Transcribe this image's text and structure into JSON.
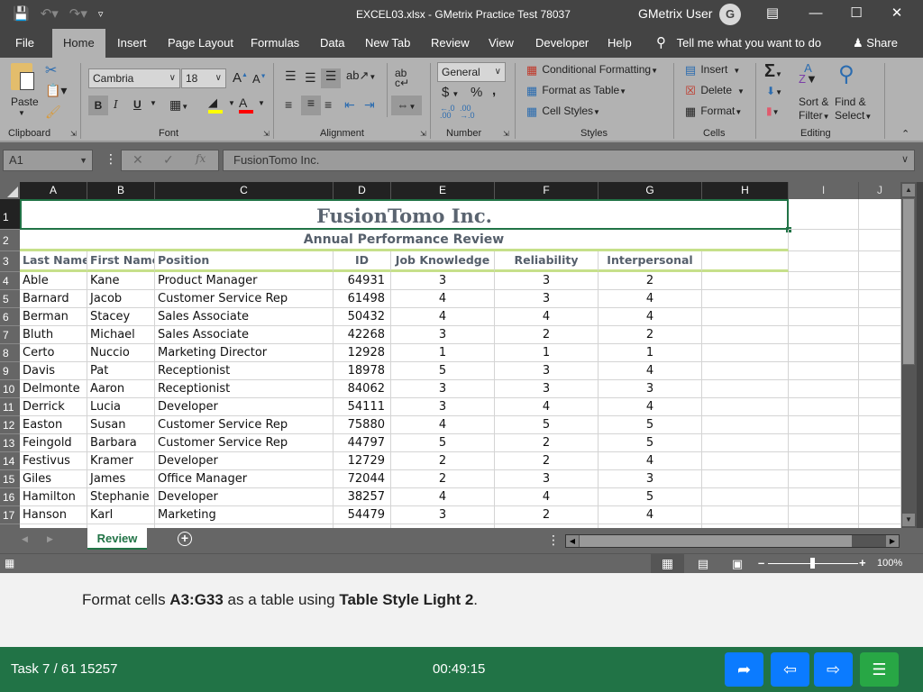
{
  "window": {
    "title": "EXCEL03.xlsx  -  GMetrix Practice Test 78037",
    "user_name": "GMetrix User",
    "user_initial": "G"
  },
  "quick_access": {
    "save_icon": "save-icon",
    "undo_icon": "undo-icon",
    "redo_icon": "redo-icon",
    "customize_icon": "customize-qat-icon"
  },
  "ribbon_tabs": [
    {
      "label": "File"
    },
    {
      "label": "Home",
      "active": true
    },
    {
      "label": "Insert"
    },
    {
      "label": "Page Layout"
    },
    {
      "label": "Formulas"
    },
    {
      "label": "Data"
    },
    {
      "label": "New Tab"
    },
    {
      "label": "Review"
    },
    {
      "label": "View"
    },
    {
      "label": "Developer"
    },
    {
      "label": "Help"
    }
  ],
  "tell_me": "Tell me what you want to do",
  "share": "Share",
  "ribbon": {
    "clipboard": {
      "label": "Clipboard",
      "paste": "Paste"
    },
    "font": {
      "label": "Font",
      "font_name": "Cambria",
      "font_size": "18",
      "bold": "B",
      "italic": "I",
      "underline": "U",
      "fill_color": "#ffff00",
      "font_color": "#ff0000"
    },
    "alignment": {
      "label": "Alignment"
    },
    "number": {
      "label": "Number",
      "format": "General",
      "currency": "$",
      "percent": "%",
      "comma": ","
    },
    "styles": {
      "label": "Styles",
      "conditional_formatting": "Conditional Formatting",
      "format_as_table": "Format as Table",
      "cell_styles": "Cell Styles"
    },
    "cells": {
      "label": "Cells",
      "insert": "Insert",
      "delete": "Delete",
      "format": "Format"
    },
    "editing": {
      "label": "Editing",
      "sort_filter_1": "Sort &",
      "sort_filter_2": "Filter",
      "find_select_1": "Find &",
      "find_select_2": "Select"
    }
  },
  "formula_bar": {
    "name_box": "A1",
    "fx": "fx",
    "content": "FusionTomo Inc."
  },
  "columns": [
    "A",
    "B",
    "C",
    "D",
    "E",
    "F",
    "G",
    "H",
    "I",
    "J"
  ],
  "sheet": {
    "title": "FusionTomo Inc.",
    "subtitle": "Annual Performance Review",
    "headers": [
      "Last Name",
      "First Name",
      "Position",
      "ID",
      "Job Knowledge",
      "Reliability",
      "Interpersonal"
    ],
    "rows": [
      {
        "row": "4",
        "cells": [
          "Able",
          "Kane",
          "Product Manager",
          "64931",
          "3",
          "3",
          "2"
        ]
      },
      {
        "row": "5",
        "cells": [
          "Barnard",
          "Jacob",
          "Customer Service Rep",
          "61498",
          "4",
          "3",
          "4"
        ]
      },
      {
        "row": "6",
        "cells": [
          "Berman",
          "Stacey",
          "Sales Associate",
          "50432",
          "4",
          "4",
          "4"
        ]
      },
      {
        "row": "7",
        "cells": [
          "Bluth",
          "Michael",
          "Sales Associate",
          "42268",
          "3",
          "2",
          "2"
        ]
      },
      {
        "row": "8",
        "cells": [
          "Certo",
          "Nuccio",
          "Marketing Director",
          "12928",
          "1",
          "1",
          "1"
        ]
      },
      {
        "row": "9",
        "cells": [
          "Davis",
          "Pat",
          "Receptionist",
          "18978",
          "5",
          "3",
          "4"
        ]
      },
      {
        "row": "10",
        "cells": [
          "Delmonte",
          "Aaron",
          "Receptionist",
          "84062",
          "3",
          "3",
          "3"
        ]
      },
      {
        "row": "11",
        "cells": [
          "Derrick",
          "Lucia",
          "Developer",
          "54111",
          "3",
          "4",
          "4"
        ]
      },
      {
        "row": "12",
        "cells": [
          "Easton",
          "Susan",
          "Customer Service Rep",
          "75880",
          "4",
          "5",
          "5"
        ]
      },
      {
        "row": "13",
        "cells": [
          "Feingold",
          "Barbara",
          "Customer Service Rep",
          "44797",
          "5",
          "2",
          "5"
        ]
      },
      {
        "row": "14",
        "cells": [
          "Festivus",
          "Kramer",
          "Developer",
          "12729",
          "2",
          "2",
          "4"
        ]
      },
      {
        "row": "15",
        "cells": [
          "Giles",
          "James",
          "Office Manager",
          "72044",
          "2",
          "3",
          "3"
        ]
      },
      {
        "row": "16",
        "cells": [
          "Hamilton",
          "Stephanie",
          "Developer",
          "38257",
          "4",
          "4",
          "5"
        ]
      },
      {
        "row": "17",
        "cells": [
          "Hanson",
          "Karl",
          "Marketing",
          "54479",
          "3",
          "2",
          "4"
        ]
      }
    ]
  },
  "sheet_tabs": [
    {
      "label": "Review",
      "active": true
    }
  ],
  "status": {
    "zoom": "100%"
  },
  "task": {
    "instruction_prefix": "Format cells ",
    "instruction_range": "A3:G33",
    "instruction_mid": " as a table using ",
    "instruction_style": "Table Style Light 2",
    "instruction_suffix": ".",
    "counter": "Task 7 / 61 15257",
    "timer": "00:49:15"
  },
  "colors": {
    "accent_green": "#217346",
    "header_underline": "#c6e08a",
    "footer_blue": "#0b7bff",
    "footer_menu_green": "#28a745"
  }
}
